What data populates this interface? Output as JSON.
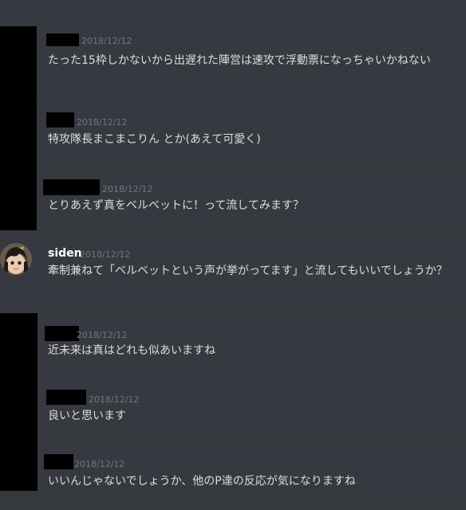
{
  "messages": [
    {
      "username": "",
      "timestamp": "2018/12/12",
      "text": "たった15枠しかないから出遅れた陣営は速攻で浮動票になっちゃいかねない"
    },
    {
      "username": "",
      "timestamp": "2018/12/12",
      "text": "特攻隊長まこまこりん とか(あえて可愛く)"
    },
    {
      "username": "",
      "timestamp": "2018/12/12",
      "text": "とりあえず真をベルベットに！って流してみます？"
    },
    {
      "username": "siden",
      "timestamp": "2018/12/12",
      "text": "牽制兼ねて「ベルベットという声が挙がってます」と流してもいいでしょうか？",
      "avatar": "user-avatar-icon"
    },
    {
      "username": "",
      "timestamp": "2018/12/12",
      "text": "近未来は真はどれも似あいますね"
    },
    {
      "username": "",
      "timestamp": "2018/12/12",
      "text": "良いと思います"
    },
    {
      "username": "",
      "timestamp": "2018/12/12",
      "text": "いいんじゃないでしょうか、他のP達の反応が気になりますね"
    }
  ],
  "colors": {
    "background": "#36393f",
    "text": "#dcddde",
    "timestamp": "#72767d",
    "username": "#ffffff",
    "redaction": "#000000"
  }
}
